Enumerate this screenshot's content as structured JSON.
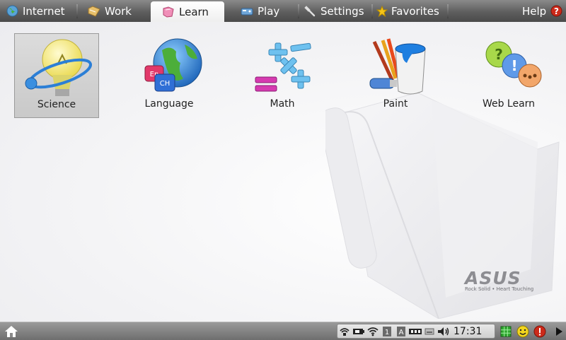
{
  "tabs": [
    {
      "label": "Internet",
      "icon": "globe-icon"
    },
    {
      "label": "Work",
      "icon": "folder-icon"
    },
    {
      "label": "Learn",
      "icon": "book-icon",
      "active": true
    },
    {
      "label": "Play",
      "icon": "gamepad-icon"
    },
    {
      "label": "Settings",
      "icon": "wrench-icon"
    },
    {
      "label": "Favorites",
      "icon": "star-icon"
    }
  ],
  "help": {
    "label": "Help",
    "icon": "help-icon"
  },
  "apps": [
    {
      "label": "Science",
      "icon": "lightbulb-icon",
      "selected": true
    },
    {
      "label": "Language",
      "icon": "language-globe-icon"
    },
    {
      "label": "Math",
      "icon": "math-symbols-icon"
    },
    {
      "label": "Paint",
      "icon": "paint-bucket-icon"
    },
    {
      "label": "Web Learn",
      "icon": "web-learn-icon"
    }
  ],
  "brand": {
    "name": "ASUS",
    "tagline": "Rock Solid • Heart Touching"
  },
  "taskbar": {
    "clock": "17:31",
    "tray_icons": [
      "network-icon",
      "battery-icon",
      "wifi-icon",
      "keyboard-layout-icon",
      "font-icon",
      "usb-icon",
      "disk-icon",
      "volume-icon"
    ],
    "right_icons": [
      "grid-icon",
      "smiley-icon",
      "power-icon",
      "arrow-right-icon"
    ],
    "home_icon": "home-icon"
  },
  "colors": {
    "accent_red": "#cc2a1a",
    "tray_green": "#2fa52f",
    "smiley_yellow": "#f2d51e"
  }
}
